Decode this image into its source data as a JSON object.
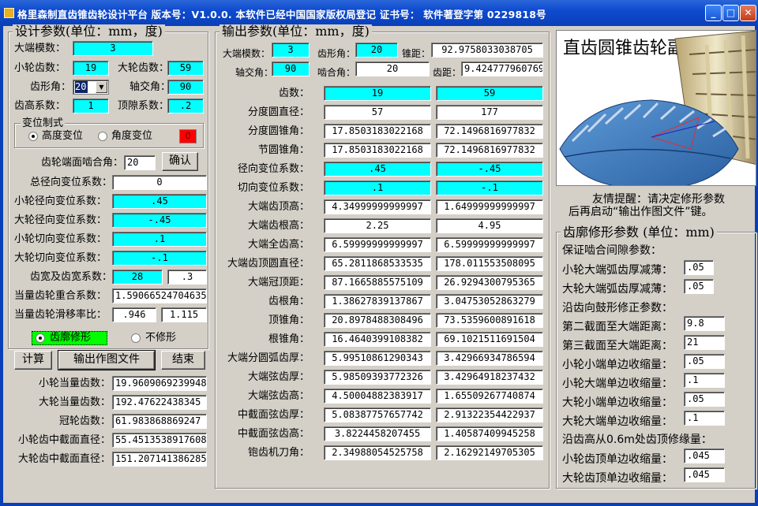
{
  "window": {
    "title": "格里森制直齿锥齿轮设计平台   版本号：V1.0.0.      本软件已经中国国家版权局登记   证书号：   软件著登字第 0229818号"
  },
  "design": {
    "title": "设计参数(单位：mm，度)",
    "module_label": "大端模数：",
    "module": "3",
    "z1_label": "小轮齿数：",
    "z1": "19",
    "z2_label": "大轮齿数：",
    "z2": "59",
    "pressure_label": "齿形角：",
    "pressure": "20",
    "shaft_label": "轴交角：",
    "shaft": "90",
    "addendum_label": "齿高系数：",
    "addendum": "1",
    "clearance_label": "顶隙系数：",
    "clearance": ".2",
    "shift_title": "变位制式",
    "shift_height": "高度变位",
    "shift_angle": "角度变位",
    "shift_flag": "0",
    "mesh_label": "齿轮端面啮合角：",
    "mesh": "20",
    "confirm": "确认",
    "total_label": "总径向变位系数：",
    "total": "0",
    "x1_label": "小轮径向变位系数：",
    "x1": ".45",
    "x2_label": "大轮径向变位系数：",
    "x2": "-.45",
    "xt1_label": "小轮切向变位系数：",
    "xt1": ".1",
    "xt2_label": "大轮切向变位系数：",
    "xt2": "-.1",
    "width_label": "齿宽及齿宽系数：",
    "width": "28",
    "width_coef": ".3",
    "contact_label": "当量齿轮重合系数：",
    "contact": "1.59066524704635",
    "slide_label": "当量齿轮滑移率比：",
    "slide1": ".946",
    "slide2": "1.115",
    "modify_on": "齿廓修形",
    "modify_off": "不修形",
    "calc_btn": "计算",
    "export_btn": "输出作图文件",
    "end_btn": "结束",
    "zv1_label": "小轮当量齿数：",
    "zv1": "19.9609069239948",
    "zv2_label": "大轮当量齿数：",
    "zv2": "192.47622438345",
    "zc_label": "冠轮齿数：",
    "zc": "61.983868869247",
    "dm1_label": "小轮齿中截面直径：",
    "dm1": "55.4513538917608",
    "dm2_label": "大轮齿中截面直径：",
    "dm2": "151.207141386285"
  },
  "output": {
    "title": "输出参数(单位：mm，度)",
    "module_label": "大端模数：",
    "module": "3",
    "pa_label": "齿形角：",
    "pa": "20",
    "cone_label": "锥距：",
    "cone": "92.9758033038705",
    "shaft_label": "轴交角：",
    "shaft": "90",
    "mesh_label": "啮合角：",
    "mesh": "20",
    "pitch_label": "齿距：",
    "pitch": "9.424777960769",
    "rows": [
      {
        "label": "齿数：",
        "v1": "19",
        "v2": "59",
        "cy": true
      },
      {
        "label": "分度圆直径：",
        "v1": "57",
        "v2": "177",
        "cy": false
      },
      {
        "label": "分度圆锥角：",
        "v1": "17.8503183022168",
        "v2": "72.1496816977832",
        "cy": false
      },
      {
        "label": "节圆锥角：",
        "v1": "17.8503183022168",
        "v2": "72.1496816977832",
        "cy": false
      },
      {
        "label": "径向变位系数：",
        "v1": ".45",
        "v2": "-.45",
        "cy": true
      },
      {
        "label": "切向变位系数：",
        "v1": ".1",
        "v2": "-.1",
        "cy": true
      },
      {
        "label": "大端齿顶高：",
        "v1": "4.34999999999997",
        "v2": "1.64999999999997",
        "cy": false
      },
      {
        "label": "大端齿根高：",
        "v1": "2.25",
        "v2": "4.95",
        "cy": false
      },
      {
        "label": "大端全齿高：",
        "v1": "6.59999999999997",
        "v2": "6.59999999999997",
        "cy": false
      },
      {
        "label": "大端齿顶圆直径：",
        "v1": "65.2811868533535",
        "v2": "178.011553508095",
        "cy": false
      },
      {
        "label": "大端冠顶距：",
        "v1": "87.1665885575109",
        "v2": "26.9294300795365",
        "cy": false
      },
      {
        "label": "齿根角：",
        "v1": "1.38627839137867",
        "v2": "3.04753052863279",
        "cy": false
      },
      {
        "label": "顶锥角：",
        "v1": "20.8978488308496",
        "v2": "73.5359600891618",
        "cy": false
      },
      {
        "label": "根锥角：",
        "v1": "16.4640399108382",
        "v2": "69.1021511691504",
        "cy": false
      },
      {
        "label": "大端分圆弧齿厚：",
        "v1": "5.99510861290343",
        "v2": "3.42966934786594",
        "cy": false
      },
      {
        "label": "大端弦齿厚：",
        "v1": "5.98509393772326",
        "v2": "3.42964918237432",
        "cy": false
      },
      {
        "label": "大端弦齿高：",
        "v1": "4.50004882383917",
        "v2": "1.65509267740874",
        "cy": false
      },
      {
        "label": "中截面弦齿厚：",
        "v1": "5.08387757657742",
        "v2": "2.91322354422937",
        "cy": false
      },
      {
        "label": "中截面弦齿高：",
        "v1": "3.8224458207455",
        "v2": "1.40587409945258",
        "cy": false
      },
      {
        "label": "铇齿机刀角：",
        "v1": "2.34988054525758",
        "v2": "2.16292149705305",
        "cy": false
      }
    ]
  },
  "preview": {
    "title": "直齿圆锥齿轮副"
  },
  "hint": {
    "line1": "友情提醒：请决定修形参数",
    "line2": "后再启动“输出作图文件”键。"
  },
  "modify": {
    "title": "齿廓修形参数 (单位：mm)",
    "backlash_title": "保证啮合间隙参数：",
    "backlash_small_label": "小轮大端弧齿厚减薄：",
    "backlash_small": ".05",
    "backlash_large_label": "大轮大端弧齿厚减薄：",
    "backlash_large": ".05",
    "crown_title": "沿齿向鼓形修正参数：",
    "sec2_label": "第二截面至大端距离：",
    "sec2": "9.8",
    "sec3_label": "第三截面至大端距离：",
    "sec3": "21",
    "s_small_label": "小轮小端单边收缩量：",
    "s_small": ".05",
    "s_large_label": "小轮大端单边收缩量：",
    "s_large": ".1",
    "l_small_label": "大轮小端单边收缩量：",
    "l_small": ".05",
    "l_large_label": "大轮大端单边收缩量：",
    "l_large": ".1",
    "tip_title": "沿齿高从0.6m处齿顶修缘量：",
    "tip1_label": "小轮齿顶单边收缩量：",
    "tip1": ".045",
    "tip2_label": "大轮齿顶单边收缩量：",
    "tip2": ".045"
  },
  "colors": {
    "cyan": "#00ffff",
    "red": "#ff0000",
    "green": "#00ff00",
    "titlebar": "#0a3fb8"
  }
}
